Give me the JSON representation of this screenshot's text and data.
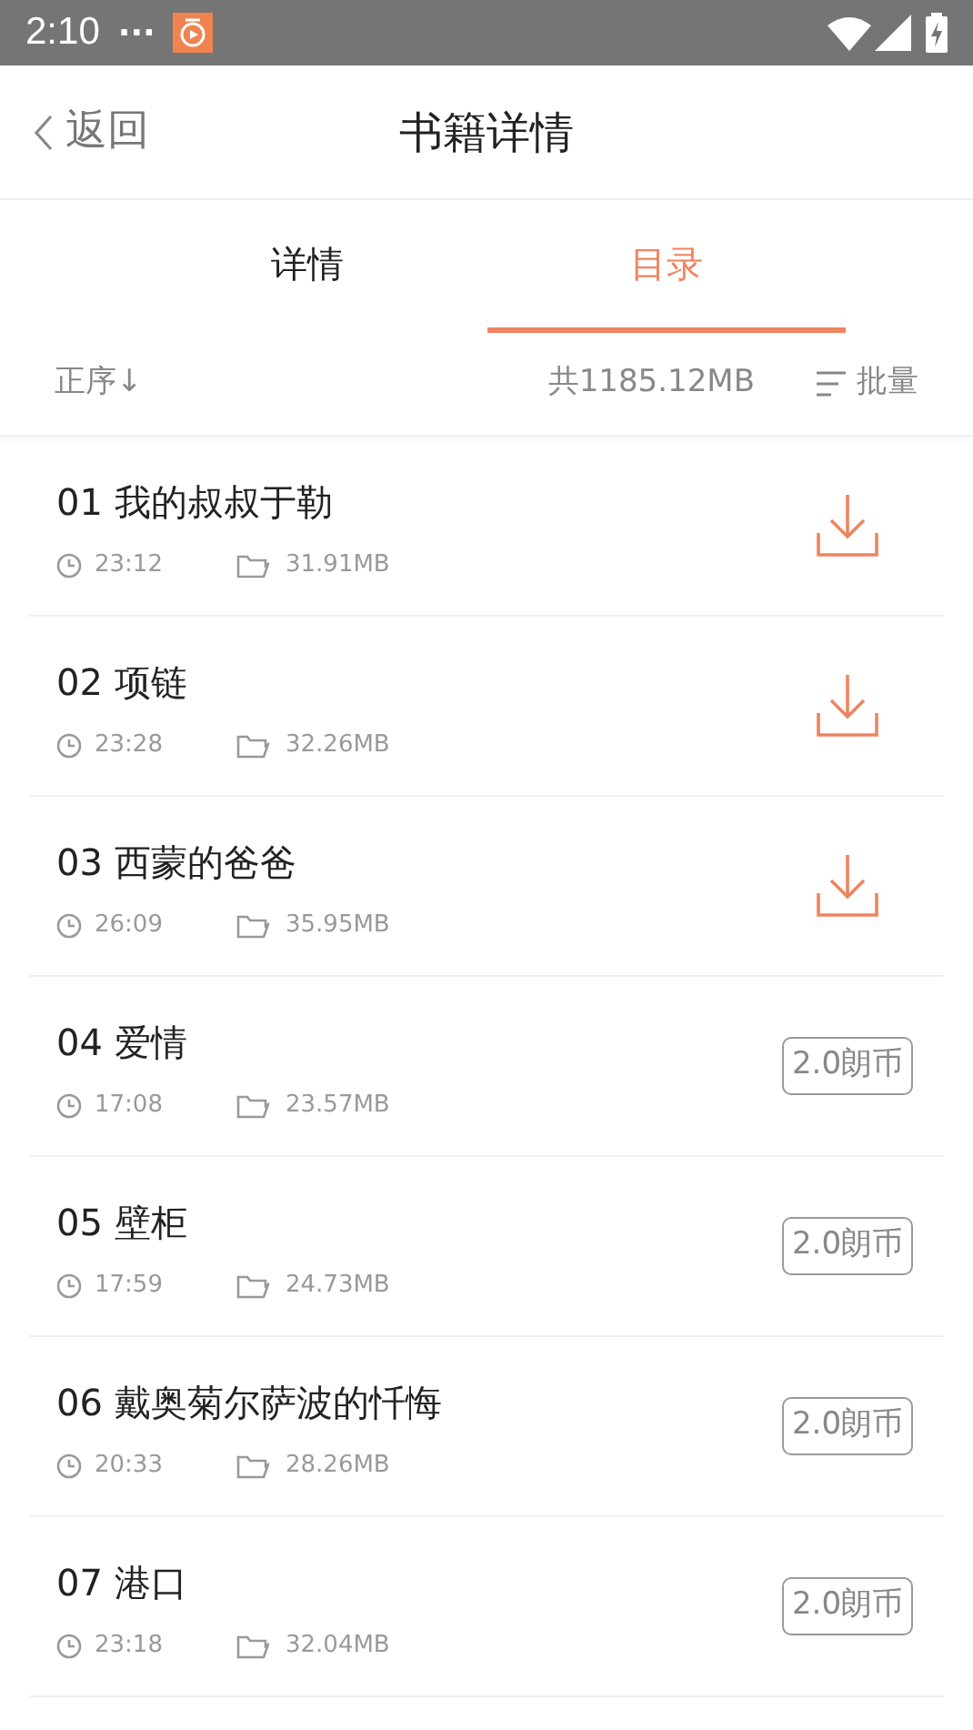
{
  "status_bar": {
    "time": "2:10",
    "dots": "···"
  },
  "header": {
    "back": "返回",
    "title": "书籍详情"
  },
  "tabs": [
    {
      "label": "详情",
      "selected": false
    },
    {
      "label": "目录",
      "selected": true
    }
  ],
  "toolbar": {
    "sort": "正序↓",
    "total": "共1185.12MB",
    "batch": "批量"
  },
  "chapters": [
    {
      "title": "01 我的叔叔于勒",
      "duration": "23:12",
      "size": "31.91MB",
      "kind": "download"
    },
    {
      "title": "02 项链",
      "duration": "23:28",
      "size": "32.26MB",
      "kind": "download"
    },
    {
      "title": "03 西蒙的爸爸",
      "duration": "26:09",
      "size": "35.95MB",
      "kind": "download"
    },
    {
      "title": "04 爱情",
      "duration": "17:08",
      "size": "23.57MB",
      "kind": "price",
      "price": "2.0朗币"
    },
    {
      "title": "05 壁柜",
      "duration": "17:59",
      "size": "24.73MB",
      "kind": "price",
      "price": "2.0朗币"
    },
    {
      "title": "06 戴奥菊尔萨波的忏悔",
      "duration": "20:33",
      "size": "28.26MB",
      "kind": "price",
      "price": "2.0朗币"
    },
    {
      "title": "07 港口",
      "duration": "23:18",
      "size": "32.04MB",
      "kind": "price",
      "price": "2.0朗币"
    }
  ]
}
